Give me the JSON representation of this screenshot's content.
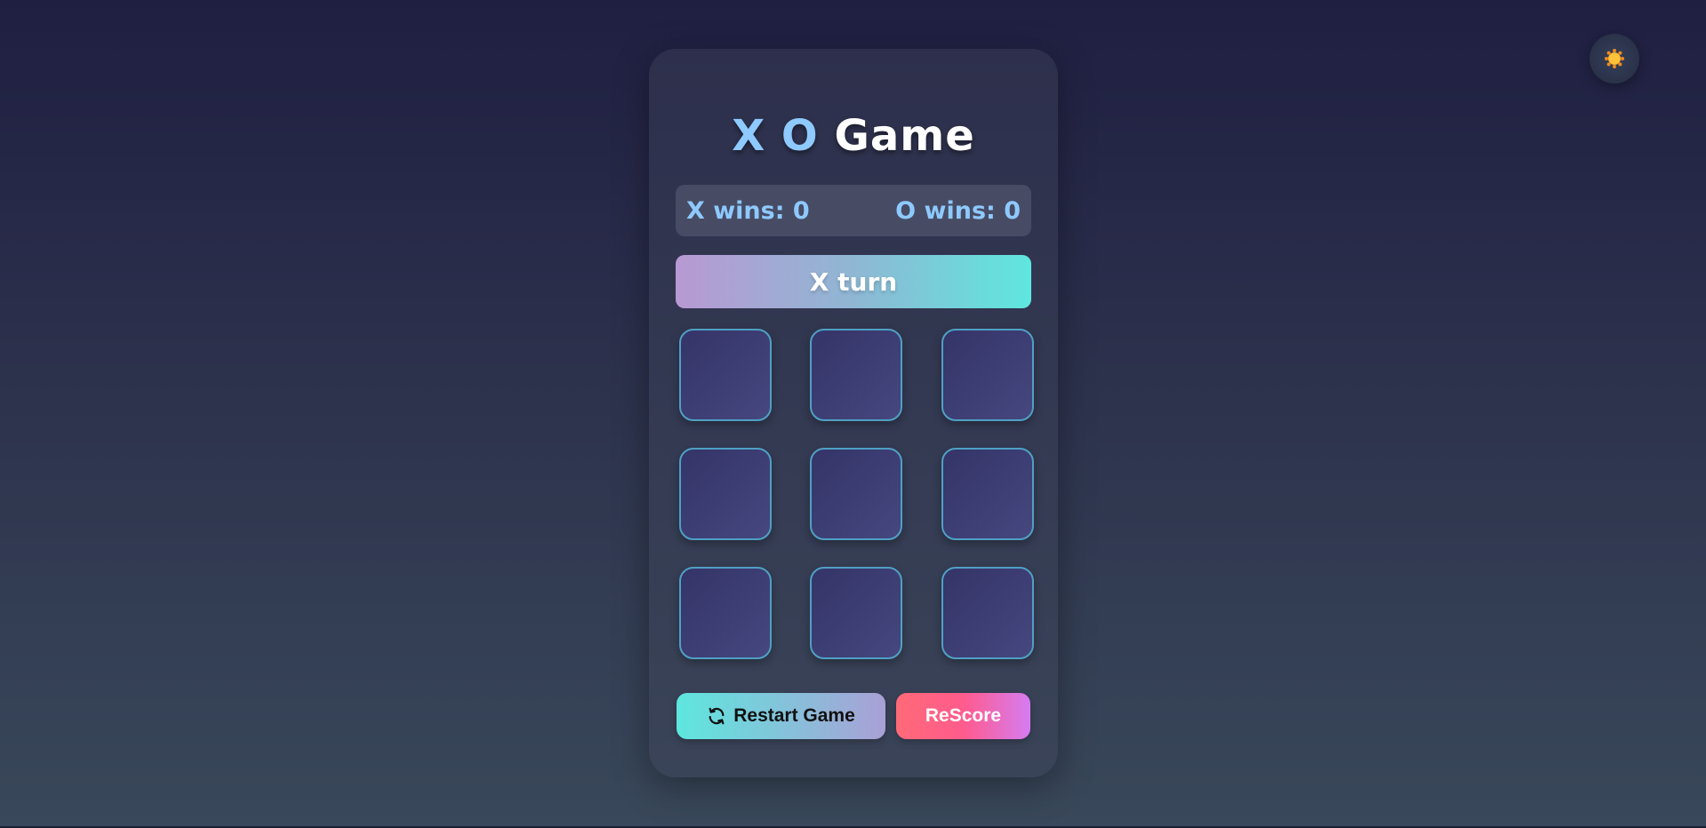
{
  "title": {
    "xo": "X O",
    "word": "Game"
  },
  "score": {
    "x_label": "X wins: 0",
    "o_label": "O wins: 0",
    "x_wins": 0,
    "o_wins": 0
  },
  "turn_status": "X turn",
  "board": {
    "cells": [
      "",
      "",
      "",
      "",
      "",
      "",
      "",
      "",
      ""
    ]
  },
  "buttons": {
    "restart": "Restart Game",
    "rescore": "ReScore"
  },
  "icons": {
    "theme": "sun-icon",
    "restart": "refresh-icon"
  },
  "colors": {
    "accent_blue": "#8ec9ff",
    "cell_border": "#4fa0c4",
    "turn_gradient_start": "#b899d3",
    "turn_gradient_end": "#5ee7de",
    "rescore_start": "#ff6a78",
    "rescore_end": "#d57cf2",
    "sun": "#f5a623"
  }
}
